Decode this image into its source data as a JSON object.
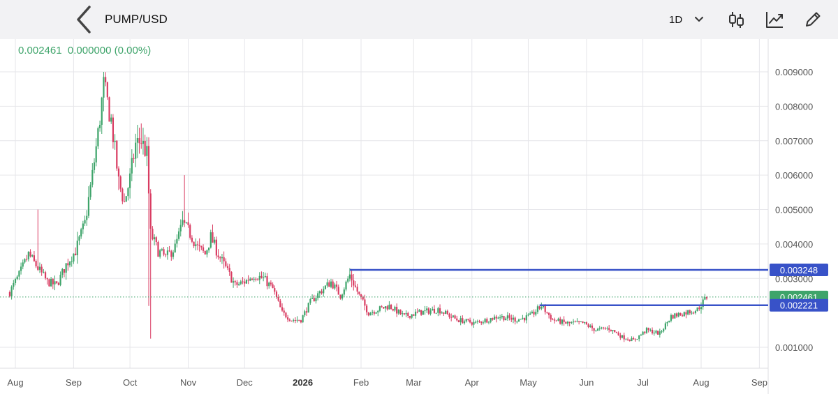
{
  "header": {
    "symbol": "PUMP/USD",
    "timeframe": "1D",
    "icons": [
      "back-chevron-icon",
      "timeframe-chevron-down-icon",
      "candlestick-chart-icon",
      "indicators-trend-icon",
      "drawing-pencil-icon"
    ]
  },
  "quote": {
    "price": "0.002461",
    "change": "0.000000",
    "change_pct": "(0.00%)"
  },
  "colors": {
    "up": "#3ea46a",
    "down": "#d93c62",
    "line": "#3852c8",
    "grid": "#e6e6ea"
  },
  "chart_data": {
    "type": "candlestick",
    "y_ticks": [
      "0.009000",
      "0.008000",
      "0.007000",
      "0.006000",
      "0.005000",
      "0.004000",
      "0.003000",
      "0.001000"
    ],
    "x_ticks": [
      "Aug",
      "Sep",
      "Oct",
      "Nov",
      "Dec",
      "2026",
      "Feb",
      "Mar",
      "Apr",
      "May",
      "Jun",
      "Jul",
      "Aug",
      "Sep"
    ],
    "ylim": [
      0.0005,
      0.0095
    ],
    "last_price": 0.002461,
    "last_price_label": "0.002461",
    "lines": [
      {
        "value": 0.003248,
        "label": "0.003248",
        "from": "2026-01-26",
        "to": "2026-08-20"
      },
      {
        "value": 0.002221,
        "label": "0.002221",
        "from": "2026-05-07",
        "to": "2026-08-20"
      }
    ],
    "price_path": [
      [
        "2025-07-29",
        0.0026
      ],
      [
        "2025-08-03",
        0.0031
      ],
      [
        "2025-08-08",
        0.0037
      ],
      [
        "2025-08-13",
        0.0033
      ],
      [
        "2025-08-18",
        0.0029
      ],
      [
        "2025-08-23",
        0.0028
      ],
      [
        "2025-08-28",
        0.0034
      ],
      [
        "2025-09-02",
        0.0038
      ],
      [
        "2025-09-07",
        0.0046
      ],
      [
        "2025-09-11",
        0.006
      ],
      [
        "2025-09-14",
        0.0072
      ],
      [
        "2025-09-17",
        0.0086
      ],
      [
        "2025-09-21",
        0.0076
      ],
      [
        "2025-09-25",
        0.0058
      ],
      [
        "2025-09-28",
        0.0052
      ],
      [
        "2025-10-01",
        0.0059
      ],
      [
        "2025-10-04",
        0.0069
      ],
      [
        "2025-10-07",
        0.007
      ],
      [
        "2025-10-10",
        0.0066
      ],
      [
        "2025-10-12",
        0.0043
      ],
      [
        "2025-10-16",
        0.0038
      ],
      [
        "2025-10-20",
        0.0036
      ],
      [
        "2025-10-25",
        0.0039
      ],
      [
        "2025-10-29",
        0.0046
      ],
      [
        "2025-11-02",
        0.0043
      ],
      [
        "2025-11-06",
        0.0039
      ],
      [
        "2025-11-10",
        0.0037
      ],
      [
        "2025-11-13",
        0.0042
      ],
      [
        "2025-11-17",
        0.0037
      ],
      [
        "2025-11-22",
        0.0032
      ],
      [
        "2025-11-26",
        0.0028
      ],
      [
        "2025-12-01",
        0.0029
      ],
      [
        "2025-12-06",
        0.0031
      ],
      [
        "2025-12-11",
        0.003
      ],
      [
        "2025-12-16",
        0.0027
      ],
      [
        "2025-12-21",
        0.002
      ],
      [
        "2025-12-26",
        0.0018
      ],
      [
        "2025-12-31",
        0.0018
      ],
      [
        "2026-01-05",
        0.0023
      ],
      [
        "2026-01-10",
        0.0026
      ],
      [
        "2026-01-16",
        0.0029
      ],
      [
        "2026-01-21",
        0.0025
      ],
      [
        "2026-01-26",
        0.0031
      ],
      [
        "2026-01-31",
        0.0025
      ],
      [
        "2026-02-05",
        0.002
      ],
      [
        "2026-02-10",
        0.0021
      ],
      [
        "2026-02-16",
        0.0022
      ],
      [
        "2026-02-24",
        0.0019
      ],
      [
        "2026-03-03",
        0.002
      ],
      [
        "2026-03-14",
        0.0021
      ],
      [
        "2026-03-24",
        0.0018
      ],
      [
        "2026-04-03",
        0.0017
      ],
      [
        "2026-04-15",
        0.0019
      ],
      [
        "2026-04-25",
        0.0018
      ],
      [
        "2026-05-02",
        0.0019
      ],
      [
        "2026-05-08",
        0.0022
      ],
      [
        "2026-05-14",
        0.0018
      ],
      [
        "2026-05-21",
        0.0017
      ],
      [
        "2026-05-30",
        0.0017
      ],
      [
        "2026-06-06",
        0.0015
      ],
      [
        "2026-06-13",
        0.00155
      ],
      [
        "2026-06-20",
        0.0013
      ],
      [
        "2026-06-26",
        0.0012
      ],
      [
        "2026-07-03",
        0.0015
      ],
      [
        "2026-07-10",
        0.0014
      ],
      [
        "2026-07-16",
        0.0019
      ],
      [
        "2026-07-23",
        0.002
      ],
      [
        "2026-07-30",
        0.0021
      ],
      [
        "2026-08-04",
        0.00246
      ]
    ]
  }
}
